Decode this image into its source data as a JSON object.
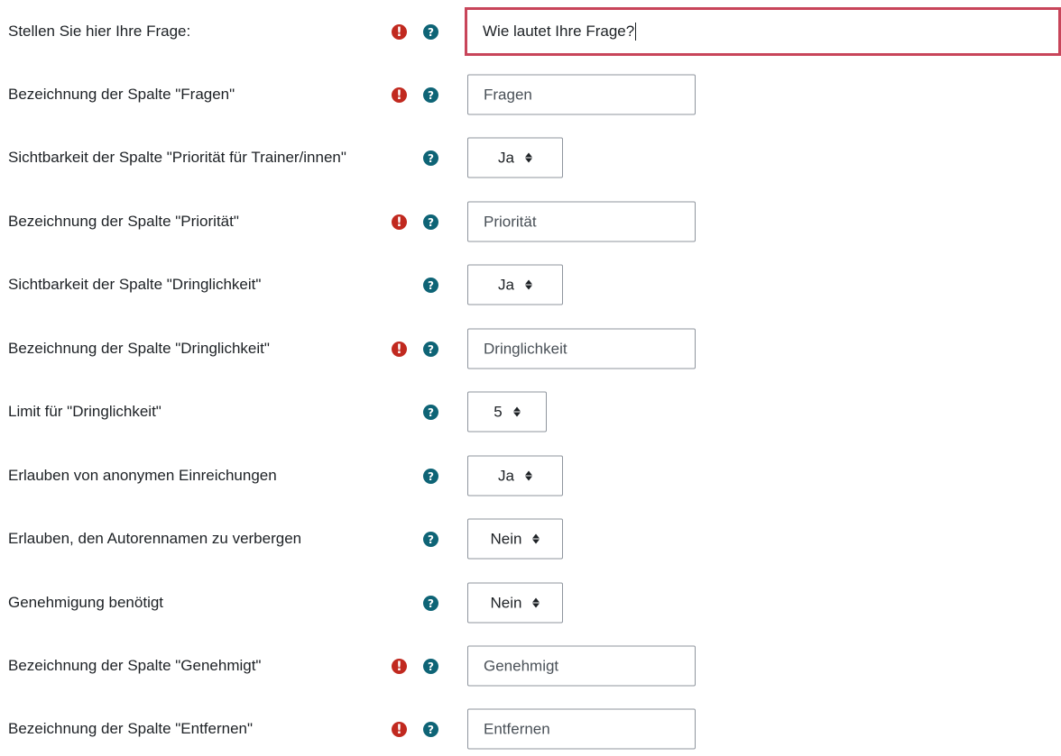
{
  "question": {
    "label": "Stellen Sie hier Ihre Frage:",
    "value": "Wie lautet Ihre Frage?",
    "required": true
  },
  "fields": [
    {
      "label": "Bezeichnung der Spalte \"Fragen\"",
      "value": "Fragen",
      "type": "text",
      "required": true
    },
    {
      "label": "Sichtbarkeit der Spalte \"Priorität für Trainer/innen\"",
      "value": "Ja",
      "type": "select",
      "required": false
    },
    {
      "label": "Bezeichnung der Spalte \"Priorität\"",
      "value": "Priorität",
      "type": "text",
      "required": true
    },
    {
      "label": "Sichtbarkeit der Spalte \"Dringlichkeit\"",
      "value": "Ja",
      "type": "select",
      "required": false
    },
    {
      "label": "Bezeichnung der Spalte \"Dringlichkeit\"",
      "value": "Dringlichkeit",
      "type": "text",
      "required": true
    },
    {
      "label": "Limit für \"Dringlichkeit\"",
      "value": "5",
      "type": "select",
      "required": false
    },
    {
      "label": "Erlauben von anonymen Einreichungen",
      "value": "Ja",
      "type": "select",
      "required": false
    },
    {
      "label": "Erlauben, den Autorennamen zu verbergen",
      "value": "Nein",
      "type": "select",
      "required": false
    },
    {
      "label": "Genehmigung benötigt",
      "value": "Nein",
      "type": "select",
      "required": false
    },
    {
      "label": "Bezeichnung der Spalte \"Genehmigt\"",
      "value": "Genehmigt",
      "type": "text",
      "required": true
    },
    {
      "label": "Bezeichnung der Spalte \"Entfernen\"",
      "value": "Entfernen",
      "type": "text",
      "required": true
    }
  ],
  "icons": {
    "required": "exclamation-circle-icon",
    "help": "question-circle-icon"
  },
  "colors": {
    "required": "#c1291f",
    "help": "#0e6476",
    "focus_border": "#c8455a"
  }
}
